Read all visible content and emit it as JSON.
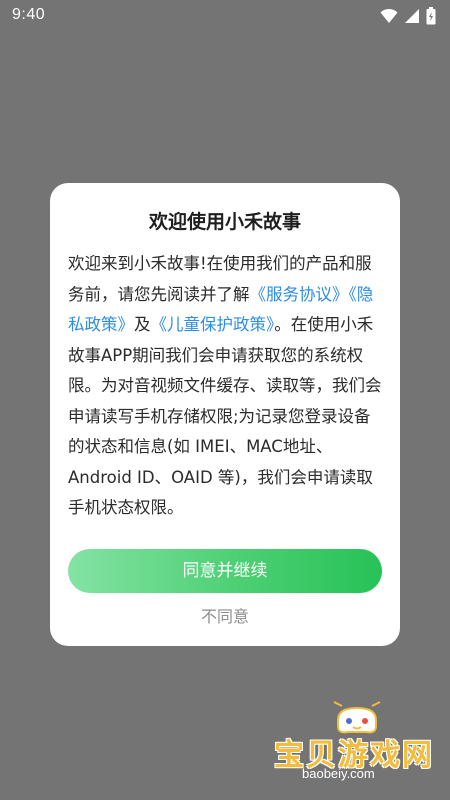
{
  "status_bar": {
    "time": "9:40",
    "icons": [
      "wifi-icon",
      "signal-icon",
      "battery-icon"
    ]
  },
  "dialog": {
    "title": "欢迎使用小禾故事",
    "body": {
      "intro": "欢迎来到小禾故事!在使用我们的产品和服务前，请您先阅读并了解",
      "link_service": "《服务协议》",
      "link_privacy": "《隐私政策》",
      "conj": "及",
      "link_children": "《儿童保护政策》",
      "rest": "。在使用小禾故事APP期间我们会申请获取您的系统权限。为对音视频文件缓存、读取等，我们会申请读写手机存储权限;为记录您登录设备的状态和信息(如 IMEI、MAC地址、Android ID、OAID 等)，我们会申请读取手机状态权限。"
    },
    "agree_label": "同意并继续",
    "disagree_label": "不同意"
  },
  "colors": {
    "overlay": "#737473",
    "link": "#2e8de6",
    "button_gradient_start": "#84e3a4",
    "button_gradient_end": "#27c257"
  },
  "watermark": {
    "cn": "宝贝游戏网",
    "en": "baobeiy.com"
  }
}
